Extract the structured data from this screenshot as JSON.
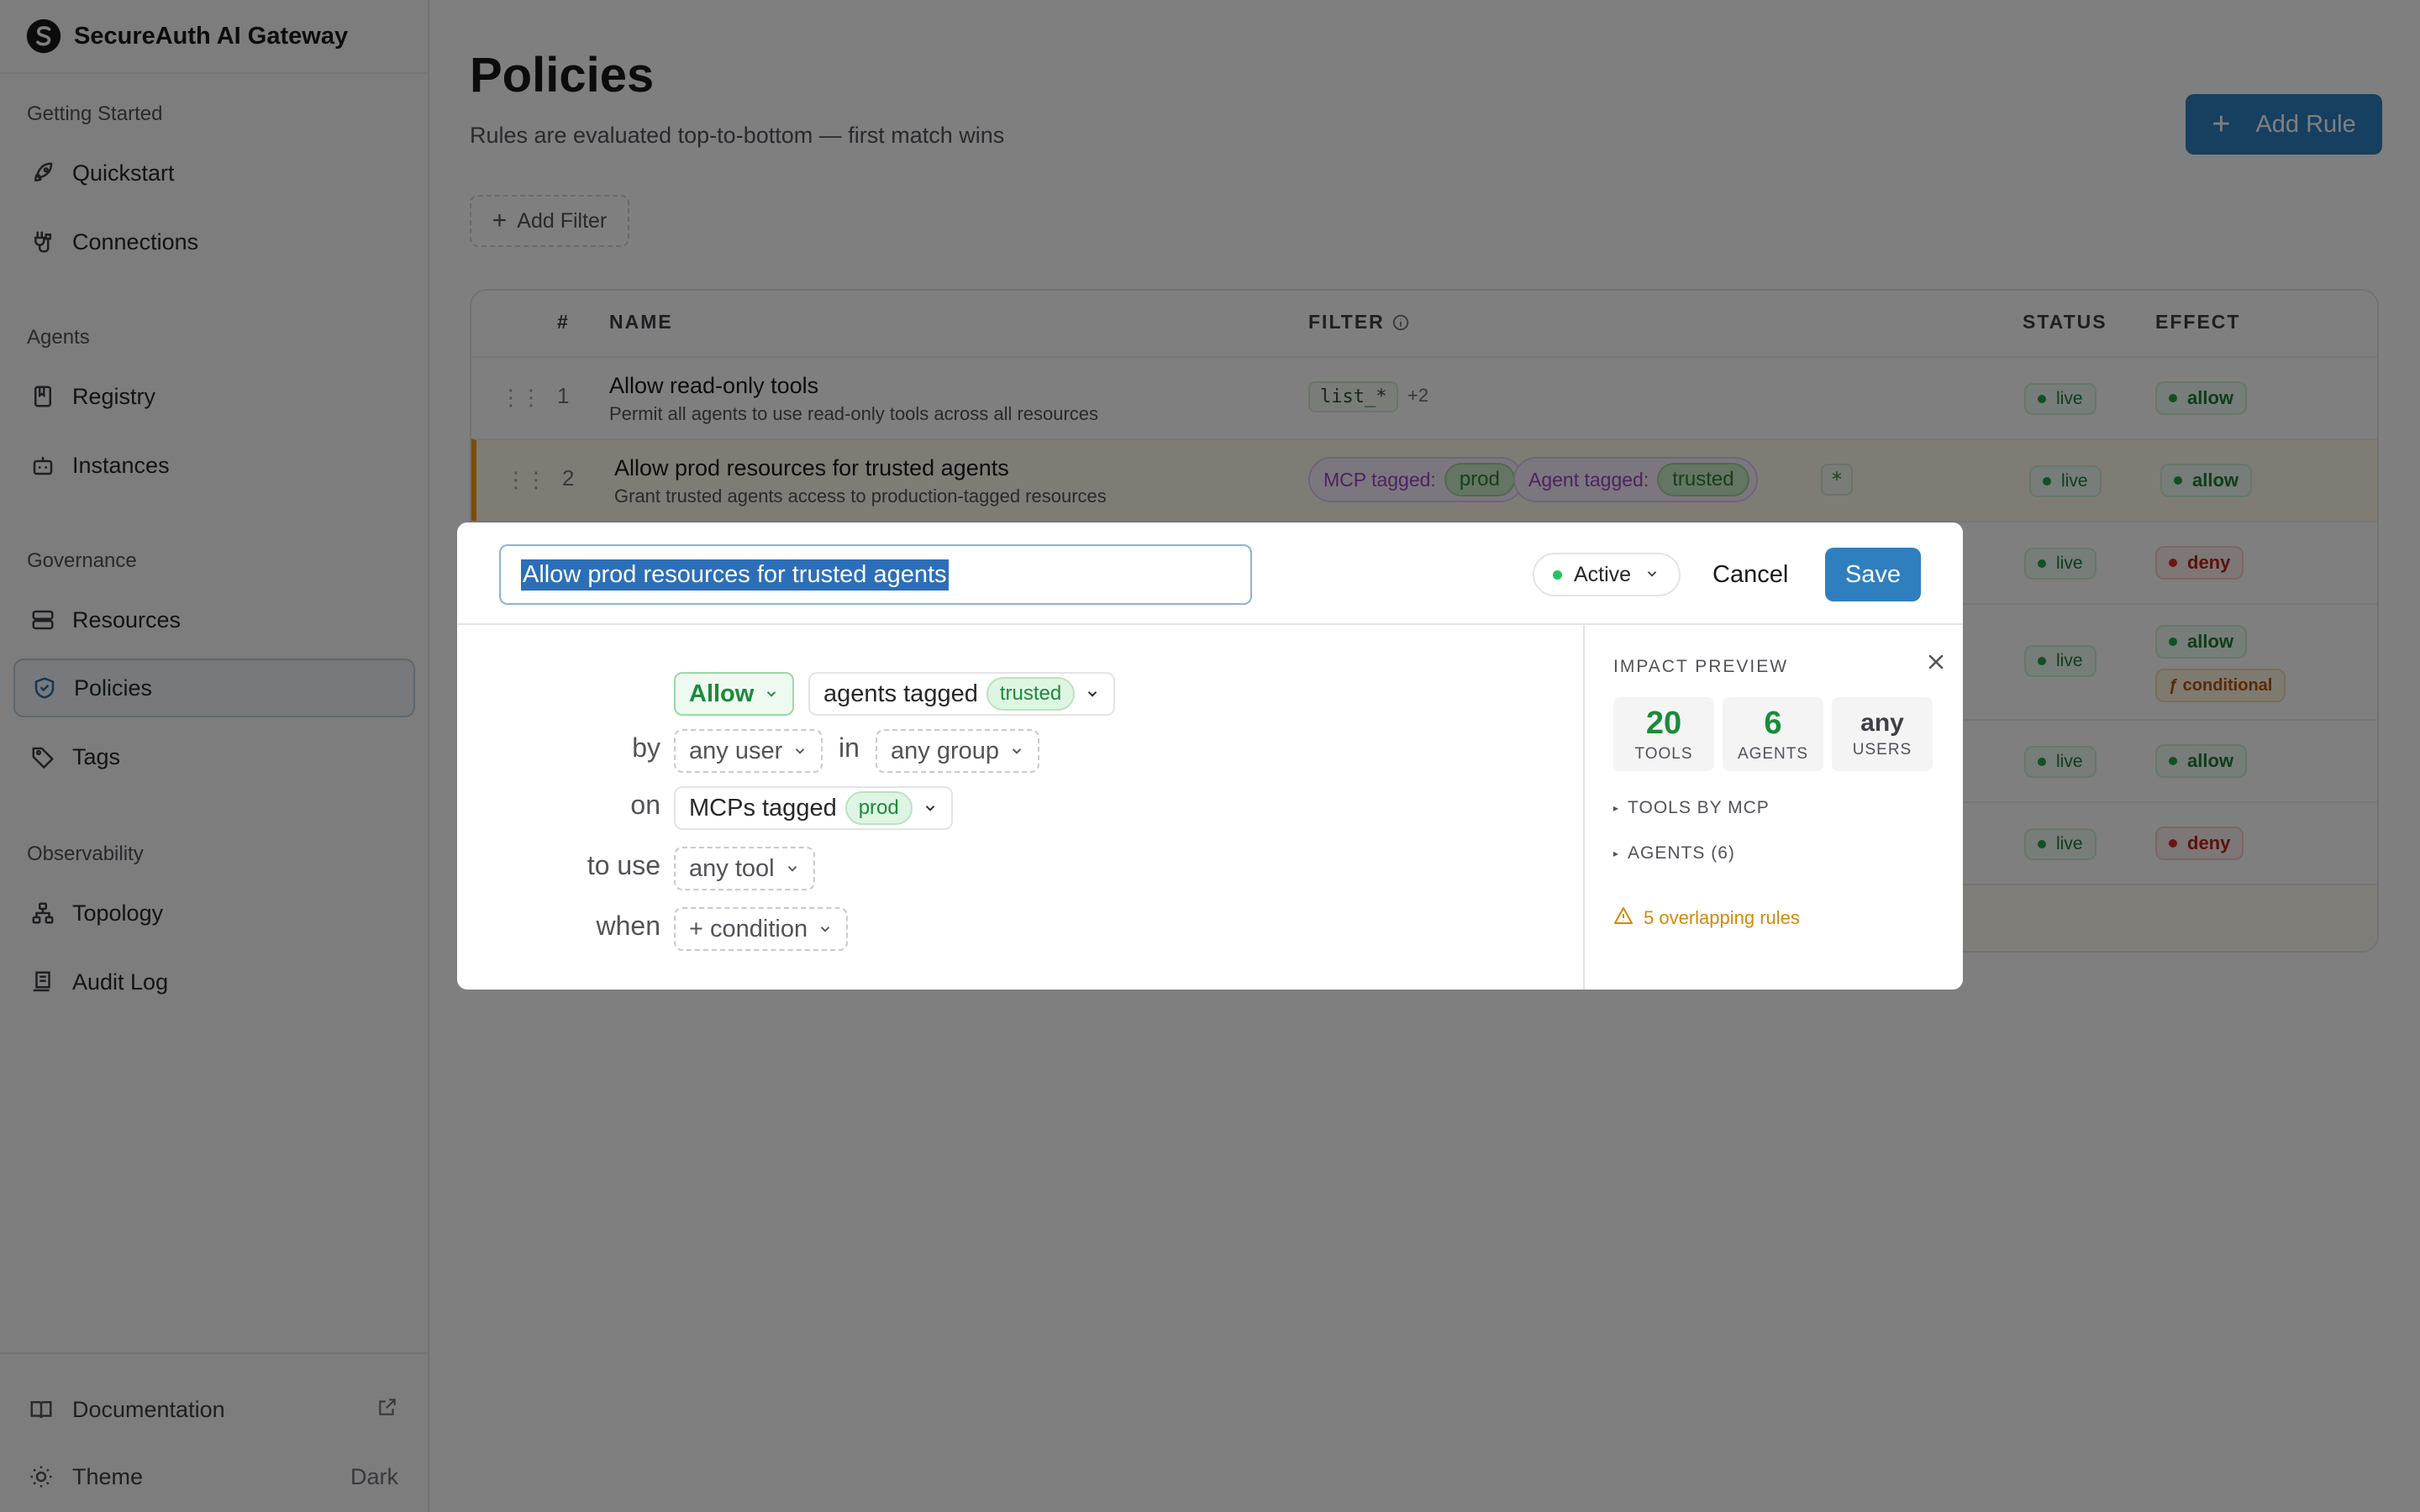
{
  "app": {
    "title": "SecureAuth AI Gateway"
  },
  "sidebar": {
    "sections": [
      {
        "label": "Getting Started"
      },
      {
        "label": "Agents"
      },
      {
        "label": "Governance"
      },
      {
        "label": "Observability"
      }
    ],
    "items": [
      {
        "label": "Quickstart",
        "icon": "rocket-icon"
      },
      {
        "label": "Connections",
        "icon": "plug-icon"
      },
      {
        "label": "Registry",
        "icon": "book-icon"
      },
      {
        "label": "Instances",
        "icon": "bot-icon"
      },
      {
        "label": "Resources",
        "icon": "server-icon"
      },
      {
        "label": "Policies",
        "icon": "shield-icon",
        "active": true
      },
      {
        "label": "Tags",
        "icon": "tag-icon"
      },
      {
        "label": "Topology",
        "icon": "topology-icon"
      },
      {
        "label": "Audit Log",
        "icon": "audit-log-icon"
      }
    ],
    "footer": {
      "documentation": "Documentation",
      "theme_label": "Theme",
      "theme_value": "Dark"
    }
  },
  "page": {
    "title": "Policies",
    "subtitle": "Rules are evaluated top-to-bottom — first match wins",
    "add_rule": "Add Rule",
    "add_filter": "Add Filter"
  },
  "table": {
    "headers": {
      "num": "#",
      "name": "NAME",
      "filter": "FILTER",
      "status": "STATUS",
      "effect": "EFFECT"
    },
    "rows": [
      {
        "num": "1",
        "name": "Allow read-only tools",
        "desc": "Permit all agents to use read-only tools across all resources",
        "filter_code": "list_*",
        "filter_more": "+2",
        "status": "live",
        "effect": "allow"
      },
      {
        "num": "2",
        "name": "Allow prod resources for trusted agents",
        "desc": "Grant trusted agents access to production-tagged resources",
        "filter_mcp_label": "MCP tagged:",
        "filter_mcp_tag": "prod",
        "filter_agent_label": "Agent tagged:",
        "filter_agent_tag": "trusted",
        "filter_star": "*",
        "status": "live",
        "effect": "allow"
      },
      {
        "status": "live",
        "effect": "deny"
      },
      {
        "status": "live",
        "effect": "allow",
        "effect_extra": "ƒ conditional"
      },
      {
        "status": "live",
        "effect": "allow"
      },
      {
        "status": "live",
        "effect": "deny"
      }
    ]
  },
  "modal": {
    "name_value": "Allow prod resources for trusted agents",
    "status": "Active",
    "cancel": "Cancel",
    "save": "Save",
    "builder": {
      "effect": "Allow",
      "subject": "agents tagged",
      "subject_tag": "trusted",
      "kw_by": "by",
      "user": "any user",
      "kw_in": "in",
      "group": "any group",
      "kw_on": "on",
      "resource": "MCPs tagged",
      "resource_tag": "prod",
      "kw_to_use": "to use",
      "tool": "any tool",
      "kw_when": "when",
      "condition": "+ condition"
    },
    "impact": {
      "title": "IMPACT PREVIEW",
      "tools_value": "20",
      "tools_label": "TOOLS",
      "agents_value": "6",
      "agents_label": "AGENTS",
      "users_value": "any",
      "users_label": "USERS",
      "tools_by_mcp": "TOOLS BY MCP",
      "agents_list": "AGENTS (6)",
      "warning": "5 overlapping rules"
    }
  },
  "colors": {
    "accent": "#2f7fbf",
    "allow": "#1b8a3a",
    "deny": "#b42318",
    "warning": "#d48806"
  }
}
